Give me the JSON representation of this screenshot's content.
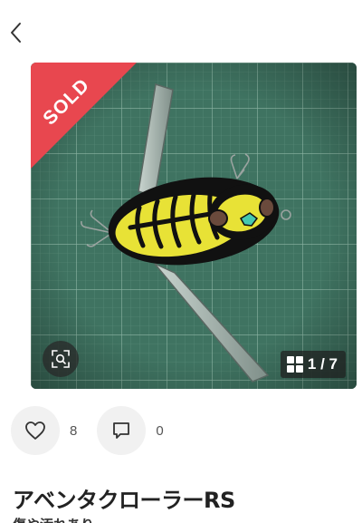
{
  "header": {
    "back_icon": "chevron-left-icon"
  },
  "photo": {
    "sold_label": "SOLD",
    "sold_color": "#e8474f",
    "zoom_icon": "image-search-icon",
    "counter_icon": "grid-icon",
    "counter": "1 / 7",
    "mat_color": "#3f7361"
  },
  "actions": {
    "like_icon": "heart-outline-icon",
    "like_count": "8",
    "comment_icon": "comment-outline-icon",
    "comment_count": "0"
  },
  "item": {
    "title": "アベンタクローラーRS",
    "subtitle": "傷や汚れあり"
  }
}
